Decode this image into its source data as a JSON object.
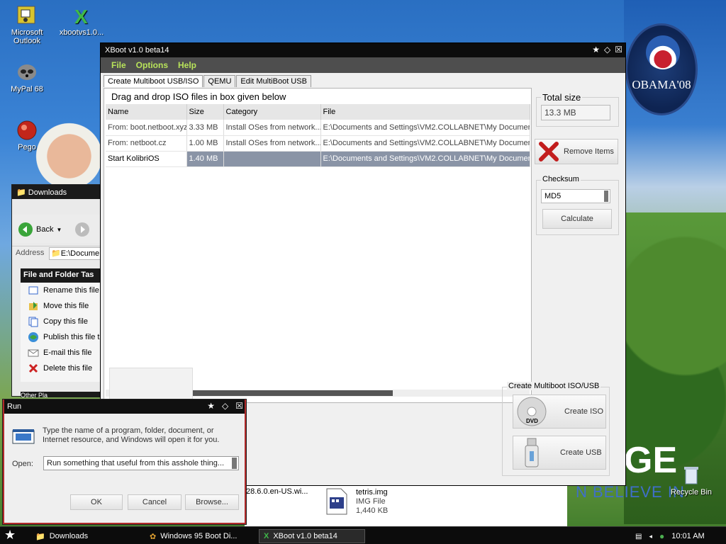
{
  "desktop": {
    "icons": [
      {
        "label": "Microsoft Outlook",
        "name": "outlook"
      },
      {
        "label": "xbootvs1.0...",
        "name": "xboot-shortcut"
      },
      {
        "label": "MyPal 68",
        "name": "mypal"
      },
      {
        "label": "Pego",
        "name": "pego"
      }
    ],
    "obama_logo_text": "OBAMA'08",
    "wallpaper_change": "GE",
    "wallpaper_believe": "N BELIEVE IN",
    "recycle_bin": "Recycle Bin"
  },
  "xboot": {
    "title": "XBoot v1.0 beta14",
    "menu": [
      "File",
      "Options",
      "Help"
    ],
    "tabs": [
      "Create Multiboot USB/ISO",
      "QEMU",
      "Edit MultiBoot USB"
    ],
    "drag_label": "Drag and drop ISO files in box given below",
    "columns": [
      "Name",
      "Size",
      "Category",
      "File"
    ],
    "rows": [
      {
        "name": "From: boot.netboot.xyz",
        "size": "3.33 MB",
        "category": "Install OSes from network...",
        "file": "E:\\Documents and Settings\\VM2.COLLABNET\\My Documen"
      },
      {
        "name": "From: netboot.cz",
        "size": "1.00 MB",
        "category": "Install OSes from network...",
        "file": "E:\\Documents and Settings\\VM2.COLLABNET\\My Documen"
      },
      {
        "name": "Start KolibriOS",
        "size": "1.40 MB",
        "category": "",
        "file": "E:\\Documents and Settings\\VM2.COLLABNET\\My Documen"
      }
    ],
    "total_size_label": "Total size",
    "total_size_value": "13.3 MB",
    "remove_items": "Remove Items",
    "checksum_label": "Checksum",
    "checksum_value": "MD5",
    "calculate": "Calculate",
    "create_group": "Create Multiboot ISO/USB",
    "create_iso": "Create ISO",
    "create_usb": "Create USB",
    "dvd_label": "DVD"
  },
  "downloads": {
    "title": "Downloads",
    "back": "Back",
    "address_label": "Address",
    "address_value": "E:\\Docume",
    "tasks_header": "File and Folder Tas",
    "tasks": [
      "Rename this file",
      "Move this file",
      "Copy this file",
      "Publish this file t",
      "E-mail this file",
      "Delete this file"
    ],
    "other_header": "Other Pla"
  },
  "run": {
    "title": "Run",
    "description": "Type the name of a program, folder, document, or Internet resource, and Windows will open it for you.",
    "open_label": "Open:",
    "open_value": "Run something that useful from this asshole thing...",
    "ok": "OK",
    "cancel": "Cancel",
    "browse": "Browse..."
  },
  "file_area": {
    "partial_name": "28.6.0.en-US.wi...",
    "file_name": "tetris.img",
    "file_type": "IMG File",
    "file_size": "1,440 KB"
  },
  "taskbar": {
    "tasks": [
      "Downloads",
      "Windows 95 Boot Di...",
      "XBoot v1.0 beta14"
    ],
    "clock": "10:01 AM"
  }
}
